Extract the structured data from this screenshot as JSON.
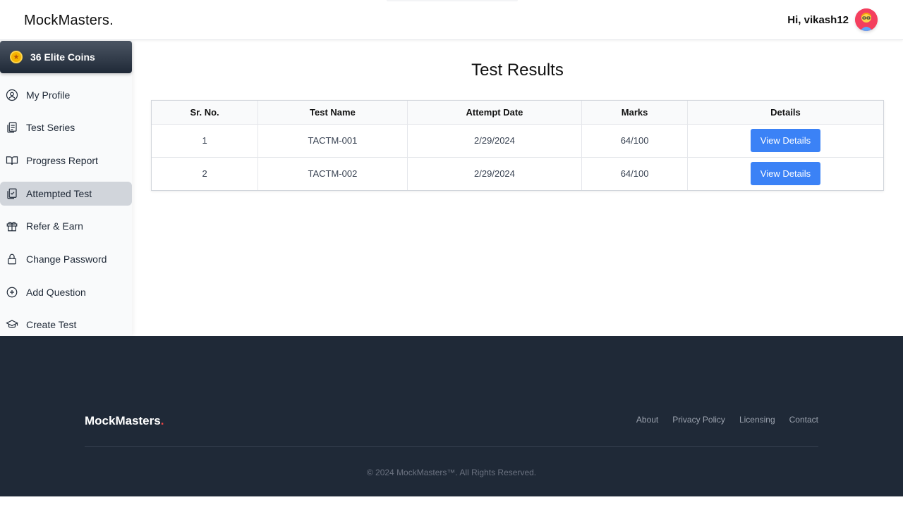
{
  "header": {
    "logo": "MockMasters.",
    "greeting": "Hi, vikash12"
  },
  "sidebar": {
    "coins_label": "36 Elite Coins",
    "items": [
      {
        "label": "My Profile",
        "icon": "user-circle-icon",
        "active": false
      },
      {
        "label": "Test Series",
        "icon": "clipboard-icon",
        "active": false
      },
      {
        "label": "Progress Report",
        "icon": "book-open-icon",
        "active": false
      },
      {
        "label": "Attempted Test",
        "icon": "clipboard-check-icon",
        "active": true
      },
      {
        "label": "Refer & Earn",
        "icon": "gift-icon",
        "active": false
      },
      {
        "label": "Change Password",
        "icon": "lock-icon",
        "active": false
      },
      {
        "label": "Add Question",
        "icon": "plus-circle-icon",
        "active": false
      },
      {
        "label": "Create Test",
        "icon": "graduation-cap-icon",
        "active": false
      }
    ]
  },
  "main": {
    "title": "Test Results",
    "table": {
      "headers": [
        "Sr. No.",
        "Test Name",
        "Attempt Date",
        "Marks",
        "Details"
      ],
      "rows": [
        {
          "sr": "1",
          "test_name": "TACTM-001",
          "date": "2/29/2024",
          "marks": "64/100",
          "action": "View Details"
        },
        {
          "sr": "2",
          "test_name": "TACTM-002",
          "date": "2/29/2024",
          "marks": "64/100",
          "action": "View Details"
        }
      ]
    }
  },
  "footer": {
    "logo_text": "MockMasters",
    "logo_dot": ".",
    "links": [
      "About",
      "Privacy Policy",
      "Licensing",
      "Contact"
    ],
    "copyright": "© 2024 MockMasters™. All Rights Reserved."
  },
  "colors": {
    "accent": "#3b82f6",
    "footer_bg": "#1f2937",
    "active_nav": "#d1d5db",
    "brand_dot": "#ef4444"
  }
}
